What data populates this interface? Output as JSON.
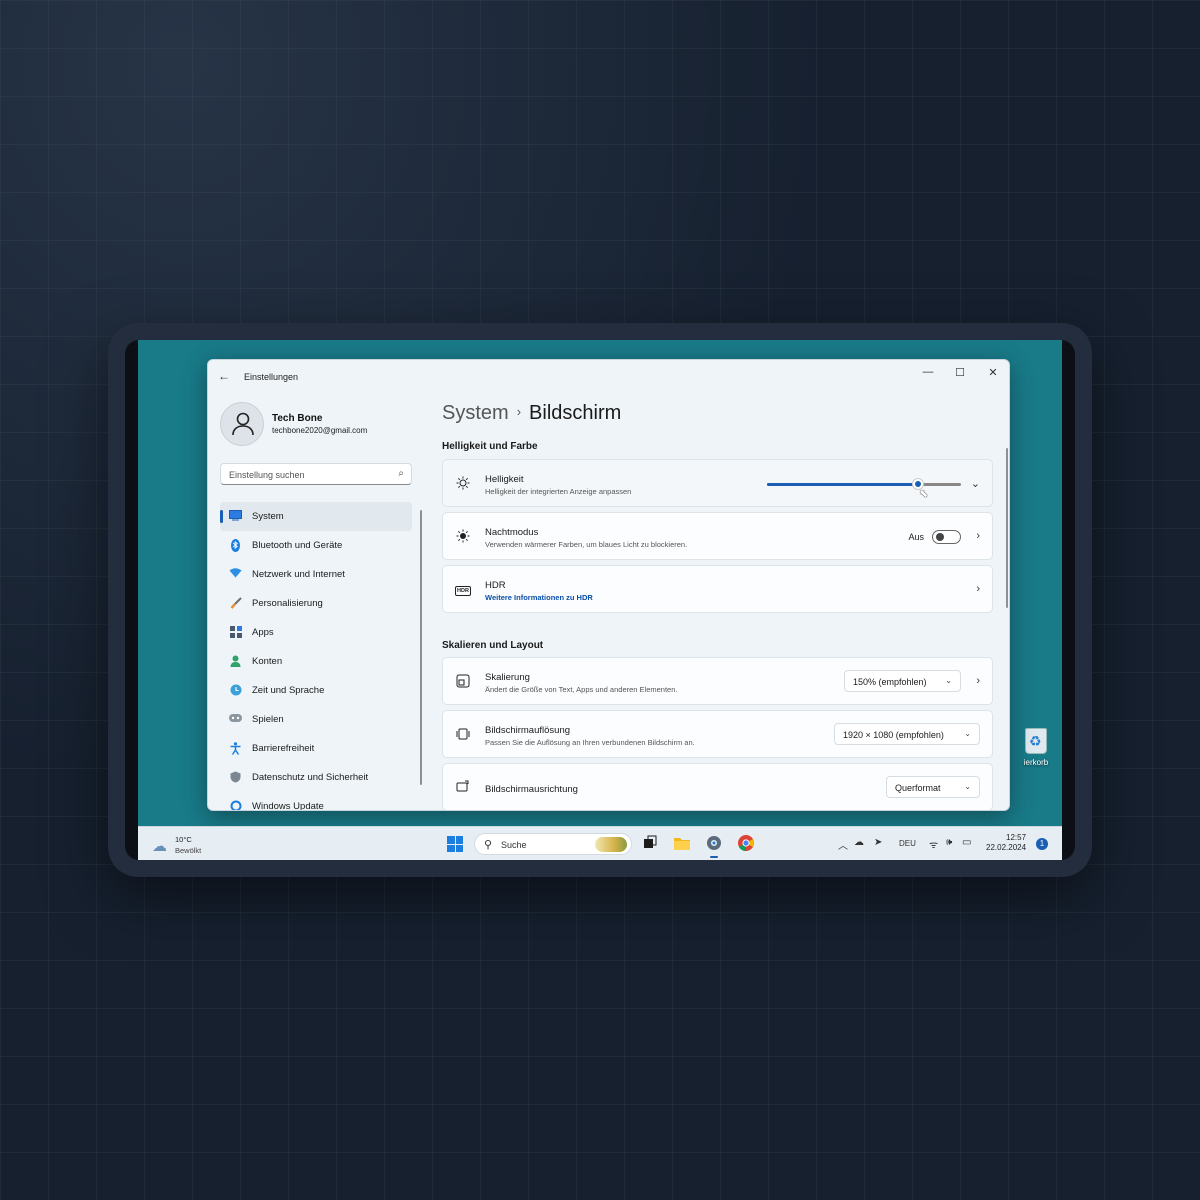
{
  "window": {
    "title": "Einstellungen",
    "minimize": "—",
    "maximize": "☐",
    "close": "✕"
  },
  "profile": {
    "name": "Tech Bone",
    "email": "techbone2020@gmail.com"
  },
  "search": {
    "placeholder": "Einstellung suchen",
    "icon": "⌕"
  },
  "sidebar": {
    "items": [
      {
        "label": "System",
        "icon": "monitor-icon"
      },
      {
        "label": "Bluetooth und Geräte",
        "icon": "bluetooth-icon"
      },
      {
        "label": "Netzwerk und Internet",
        "icon": "wifi-icon"
      },
      {
        "label": "Personalisierung",
        "icon": "brush-icon"
      },
      {
        "label": "Apps",
        "icon": "apps-icon"
      },
      {
        "label": "Konten",
        "icon": "person-icon"
      },
      {
        "label": "Zeit und Sprache",
        "icon": "globe-clock-icon"
      },
      {
        "label": "Spielen",
        "icon": "gamepad-icon"
      },
      {
        "label": "Barrierefreiheit",
        "icon": "accessibility-icon"
      },
      {
        "label": "Datenschutz und Sicherheit",
        "icon": "shield-icon"
      },
      {
        "label": "Windows Update",
        "icon": "update-icon"
      }
    ]
  },
  "breadcrumb": {
    "parent": "System",
    "separator": "›",
    "current": "Bildschirm"
  },
  "sections": {
    "brightness_color": "Helligkeit und Farbe",
    "scale_layout": "Skalieren und Layout"
  },
  "cards": {
    "brightness": {
      "title": "Helligkeit",
      "subtitle": "Helligkeit der integrierten Anzeige anpassen",
      "level": 0.78
    },
    "night": {
      "title": "Nachtmodus",
      "subtitle": "Verwenden wärmerer Farben, um blaues Licht zu blockieren.",
      "state": "Aus"
    },
    "hdr": {
      "title": "HDR",
      "link": "Weitere Informationen zu HDR",
      "icon_text": "HDR"
    },
    "scaling": {
      "title": "Skalierung",
      "subtitle": "Ändert die Größe von Text, Apps und anderen Elementen.",
      "value": "150% (empfohlen)"
    },
    "resolution": {
      "title": "Bildschirmauflösung",
      "subtitle": "Passen Sie die Auflösung an Ihren verbundenen Bildschirm an.",
      "value": "1920 × 1080 (empfohlen)"
    },
    "orientation": {
      "title": "Bildschirmausrichtung",
      "value": "Querformat"
    }
  },
  "desktop": {
    "recycle_label": "ierkorb"
  },
  "taskbar": {
    "weather_temp": "10°C",
    "weather_cond": "Bewölkt",
    "search_label": "Suche",
    "lang": "DEU",
    "time": "12:57",
    "date": "22.02.2024",
    "notifications": "1"
  },
  "colors": {
    "accent": "#1a5fb4",
    "desktop": "#197a88",
    "link": "#0a4fa8"
  }
}
